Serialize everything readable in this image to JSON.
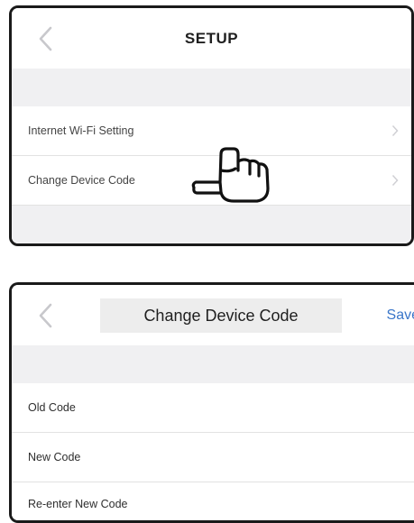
{
  "screen1": {
    "title": "SETUP",
    "back_icon": "chevron-left-icon",
    "items": [
      {
        "label": "Internet Wi-Fi Setting"
      },
      {
        "label": "Change Device Code"
      }
    ],
    "pointer_icon": "pointing-hand-icon"
  },
  "screen2": {
    "title": "Change Device Code",
    "back_icon": "chevron-left-icon",
    "save_label": "Save",
    "fields": [
      {
        "label": "Old Code"
      },
      {
        "label": "New Code"
      },
      {
        "label": "Re-enter New Code"
      }
    ]
  },
  "colors": {
    "frame": "#1a1a1a",
    "band": "#f0f0f2",
    "accent": "#3a76c9",
    "chevron": "#c8c8cc"
  }
}
